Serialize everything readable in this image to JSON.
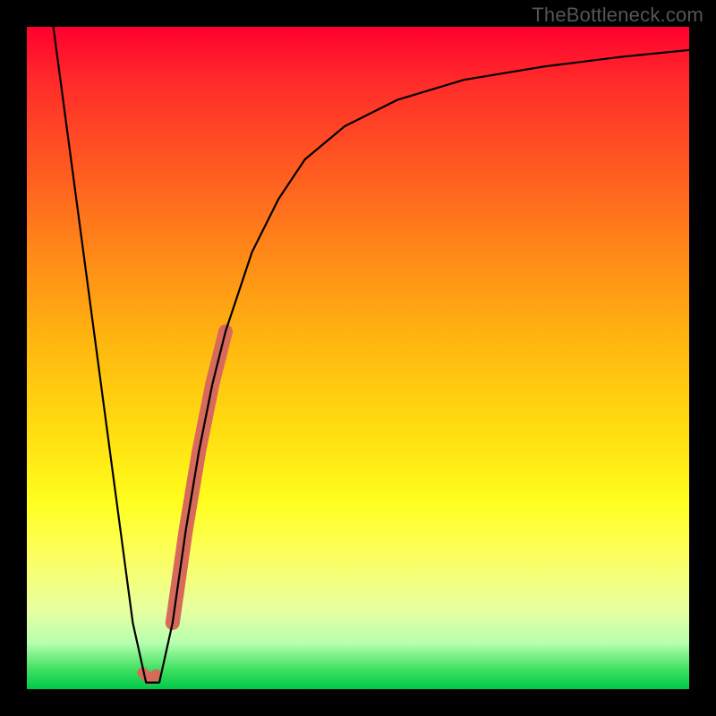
{
  "attribution": "TheBottleneck.com",
  "chart_data": {
    "type": "line",
    "title": "",
    "xlabel": "",
    "ylabel": "",
    "xlim": [
      0,
      100
    ],
    "ylim": [
      0,
      100
    ],
    "grid": false,
    "legend": false,
    "series": [
      {
        "name": "curve",
        "x": [
          4,
          6,
          8,
          10,
          12,
          14,
          16,
          18,
          20,
          22,
          24,
          26,
          28,
          30,
          34,
          38,
          42,
          48,
          56,
          66,
          78,
          90,
          100
        ],
        "y": [
          100,
          85,
          70,
          55,
          40,
          25,
          10,
          1,
          1,
          10,
          24,
          36,
          46,
          54,
          66,
          74,
          80,
          85,
          89,
          92,
          94,
          95.5,
          96.5
        ],
        "stroke": "#000000",
        "stroke_width": 2.2
      },
      {
        "name": "highlight-lower",
        "x": [
          17.5,
          18.5,
          19.5
        ],
        "y": [
          2.5,
          1.5,
          2.2
        ],
        "stroke": "#d86a5c",
        "stroke_width": 12
      },
      {
        "name": "highlight-rising",
        "x": [
          22.0,
          23.0,
          24.0,
          25.0,
          26.0,
          27.0,
          28.0,
          29.0,
          30.0
        ],
        "y": [
          10,
          17,
          24,
          30,
          36,
          41,
          46,
          50,
          54
        ],
        "stroke": "#d86a5c",
        "stroke_width": 16
      }
    ]
  }
}
